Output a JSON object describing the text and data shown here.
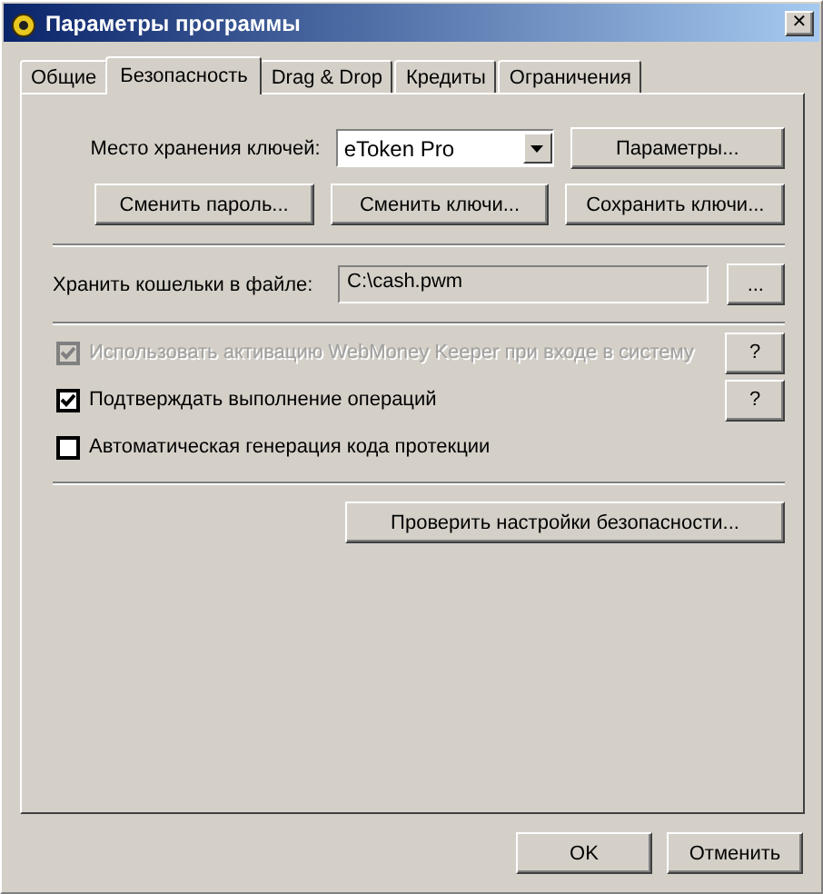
{
  "window": {
    "title": "Параметры программы",
    "close": "✕"
  },
  "tabs": [
    {
      "label": "Общие",
      "selected": false
    },
    {
      "label": "Безопасность",
      "selected": true
    },
    {
      "label": "Drag & Drop",
      "selected": false
    },
    {
      "label": "Кредиты",
      "selected": false
    },
    {
      "label": "Ограничения",
      "selected": false
    }
  ],
  "key_storage": {
    "label": "Место хранения ключей:",
    "value": "eToken Pro",
    "settings_button": "Параметры..."
  },
  "key_buttons": [
    "Сменить пароль...",
    "Сменить ключи...",
    "Сохранить ключи..."
  ],
  "wallet_file": {
    "label": "Хранить кошельки в файле:",
    "value": "C:\\cash.pwm",
    "browse_button": "..."
  },
  "options": [
    {
      "label": "Использовать активацию WebMoney Keeper при входе в систему",
      "checked": true,
      "disabled": true,
      "help": "?"
    },
    {
      "label": "Подтверждать выполнение операций",
      "checked": true,
      "disabled": false,
      "help": "?"
    },
    {
      "label": "Автоматическая генерация кода протекции",
      "checked": false,
      "disabled": false
    }
  ],
  "check_button": "Проверить настройки безопасности...",
  "buttons": [
    "OK",
    "Отменить"
  ]
}
